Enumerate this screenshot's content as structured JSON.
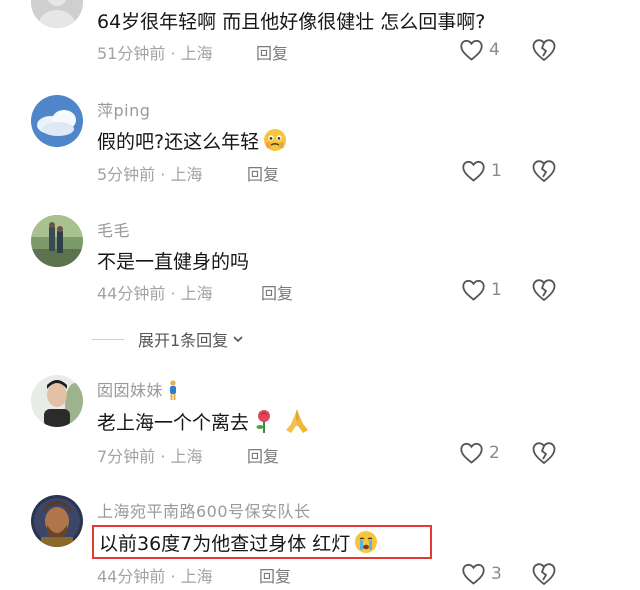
{
  "comments": [
    {
      "username": "",
      "text": "64岁很年轻啊 而且他好像很健壮 怎么回事啊?",
      "meta": "51分钟前 · 上海",
      "reply": "回复",
      "likes": "4"
    },
    {
      "username": "萍ping",
      "text": "假的吧?还这么年轻",
      "meta": "5分钟前 · 上海",
      "reply": "回复",
      "likes": "1"
    },
    {
      "username": "毛毛",
      "text": "不是一直健身的吗",
      "meta": "44分钟前 · 上海",
      "reply": "回复",
      "likes": "1"
    },
    {
      "username": "囡囡妹妹",
      "text": "老上海一个个离去",
      "meta": "7分钟前 · 上海",
      "reply": "回复",
      "likes": "2"
    },
    {
      "username": "上海宛平南路600号保安队长",
      "text": "以前36度7为他查过身体 红灯",
      "meta": "44分钟前 · 上海",
      "reply": "回复",
      "likes": "3"
    }
  ],
  "expand_replies": "展开1条回复",
  "icons": {
    "like": "heart-outline-icon",
    "dislike": "broken-heart-icon",
    "expand": "chevron-down-icon"
  },
  "colors": {
    "highlight_border": "#e43a33",
    "meta_gray": "#a3a3a3"
  }
}
